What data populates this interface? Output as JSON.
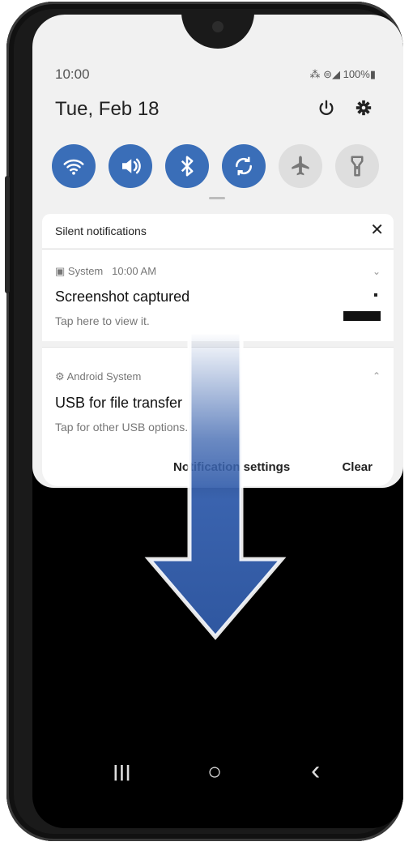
{
  "status_bar": {
    "time": "10:00",
    "right": "⁂ ⊜◢ 100%▮"
  },
  "header": {
    "date": "Tue, Feb 18",
    "power_icon": "power-icon",
    "settings_icon": "gear-icon"
  },
  "quick_settings": [
    {
      "name": "wifi",
      "state": "on"
    },
    {
      "name": "sound",
      "state": "on"
    },
    {
      "name": "bluetooth",
      "state": "on"
    },
    {
      "name": "auto-rotate",
      "state": "on"
    },
    {
      "name": "airplane-mode",
      "state": "off"
    },
    {
      "name": "flashlight",
      "state": "off"
    }
  ],
  "notifications": {
    "section_label": "Silent notifications",
    "close": "✕",
    "items": [
      {
        "app": "System",
        "time": "10:00 AM",
        "title": "Screenshot captured",
        "subtitle": "Tap here to view it."
      },
      {
        "app": "Android System",
        "title": "USB for file transfer",
        "subtitle": "Tap for other USB options."
      }
    ],
    "actions": {
      "notification_settings": "Notification settings",
      "clear": "Clear"
    }
  },
  "navbar": {
    "recents": "|||",
    "home": "○",
    "back": "‹"
  },
  "colors": {
    "accent": "#3a6eb8",
    "arrow": "#3a63ae"
  }
}
